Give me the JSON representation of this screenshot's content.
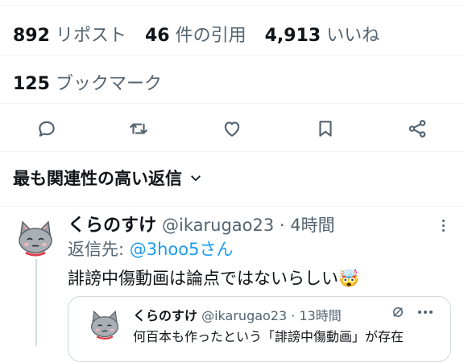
{
  "stats": {
    "reposts_count": "892",
    "reposts_label": "リポスト",
    "quotes_count": "46",
    "quotes_label": "件の引用",
    "likes_count": "4,913",
    "likes_label": "いいね"
  },
  "bookmarks": {
    "count": "125",
    "label": "ブックマーク"
  },
  "actions": [
    "reply-icon",
    "repost-icon",
    "like-icon",
    "bookmark-icon",
    "share-icon"
  ],
  "sort": {
    "label": "最も関連性の高い返信"
  },
  "reply_tweet": {
    "display_name": "くらのすけ",
    "handle": "@ikarugao23",
    "sep": " · ",
    "time": "4時間",
    "reply_to_label": "返信先: ",
    "reply_to_handle": "@3hoo5さん",
    "text": "誹謗中傷動画は論点ではないらしい🤯"
  },
  "quoted_tweet": {
    "display_name": "くらのすけ",
    "handle": "@ikarugao23",
    "sep": " · ",
    "time": "13時間",
    "text": "何百本も作ったという「誹謗中傷動画」が存在"
  },
  "colors": {
    "accent": "#1d9bf0",
    "muted": "#536471",
    "text": "#0f1419",
    "divider": "#eff3f4"
  }
}
